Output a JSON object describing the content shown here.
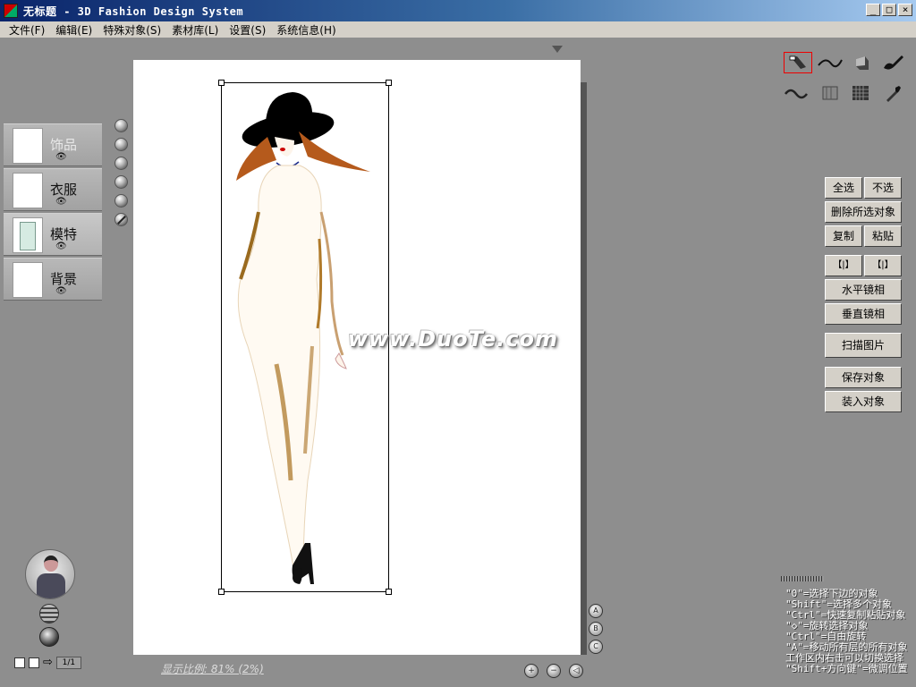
{
  "window": {
    "title": "无标题  - 3D Fashion Design System",
    "min_label": "_",
    "max_label": "□",
    "close_label": "×"
  },
  "menu": [
    {
      "label": "文件(F)"
    },
    {
      "label": "编辑(E)"
    },
    {
      "label": "特殊对象(S)"
    },
    {
      "label": "素材库(L)"
    },
    {
      "label": "设置(S)"
    },
    {
      "label": "系统信息(H)"
    }
  ],
  "layers": [
    {
      "label": "饰品",
      "eye": "👁"
    },
    {
      "label": "衣服",
      "eye": "👁"
    },
    {
      "label": "模特",
      "eye": "👁"
    },
    {
      "label": "背景",
      "eye": "👁"
    }
  ],
  "canvas": {
    "watermark": "www.DuoTe.com",
    "zoom_text": "显示比例: 81% (2%)"
  },
  "page": {
    "indicator": "1/1"
  },
  "abc_buttons": [
    "A",
    "B",
    "C"
  ],
  "bottom_controls": [
    "+",
    "−",
    "◁"
  ],
  "tools": {
    "row1": [
      {
        "icon": "eraser-icon",
        "selected": true
      },
      {
        "icon": "curve-icon"
      },
      {
        "icon": "cube-icon"
      },
      {
        "icon": "brush-icon"
      }
    ],
    "row2": [
      {
        "icon": "wave-icon"
      },
      {
        "icon": "fabric-icon"
      },
      {
        "icon": "grid-icon"
      },
      {
        "icon": "dropper-icon"
      }
    ]
  },
  "buttons": {
    "select_all": "全选",
    "deselect": "不选",
    "delete_selected": "删除所选对象",
    "copy": "复制",
    "paste": "粘贴",
    "move_left": "【|】",
    "move_right": "【|】",
    "h_mirror": "水平镜相",
    "v_mirror": "垂直镜相",
    "scan": "扫描图片",
    "save": "保存对象",
    "load": "装入对象"
  },
  "hints": [
    "\"0\"=选择下边的对象",
    "\"Shift\"=选择多个对象",
    "\"Ctrl\"=快速复制粘贴对象",
    "\"◇\"=旋转选择对象",
    "\"Ctrl\"=自由旋转",
    "\"A\"=移动所有层的所有对象",
    "工作区内右击可以切换选择",
    "\"Shift+方向键\"=微调位置"
  ]
}
